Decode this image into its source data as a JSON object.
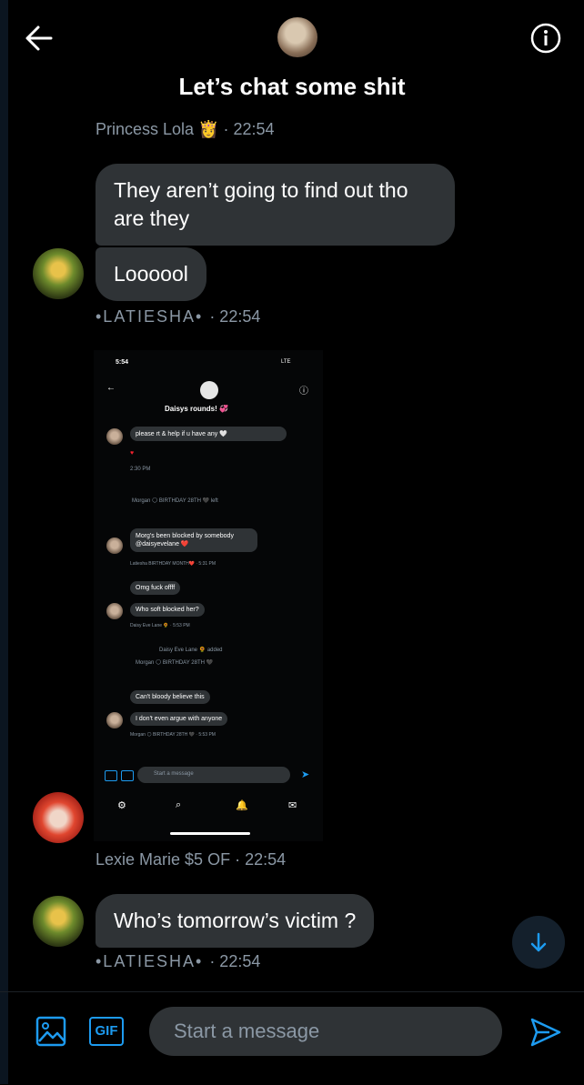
{
  "header": {
    "title": "Let’s chat some shit"
  },
  "messages": [
    {
      "sender": "Princess Lola 👸",
      "time": "· 22:54"
    },
    {
      "text": "They aren’t going to find out tho are they"
    },
    {
      "text": "Loooool"
    },
    {
      "sender": "•LATIESHA•",
      "time": "· 22:54"
    },
    {
      "sender": "Lexie Marie $5 OF",
      "time": "· 22:54"
    },
    {
      "text": "Who’s tomorrow’s victim ?"
    },
    {
      "sender": "•LATIESHA•",
      "time": "· 22:54"
    }
  ],
  "screenshot": {
    "status_time": "5:54",
    "status_net": "LTE",
    "title": "Daisys rounds! 💞",
    "m1": "please rt & help if u have any 🤍",
    "m1_time": "2:30 PM",
    "sys1": "Morgan 🌕 BIRTHDAY 28TH 🖤 left",
    "m2": "Morg's been blocked by somebody @daisyevelane ❤️",
    "m2_meta": "Latiesha BIRTHDAY MONTH❤️ · 5:31 PM",
    "m3": "Omg fuck offff",
    "m4": "Who soft blocked her?",
    "m4_meta": "Daisy Eve Lane 🌻 · 5:53 PM",
    "sys2": "Daisy Eve Lane 🌻 added",
    "sys3": "Morgan 🌕 BIRTHDAY 28TH 🖤",
    "m5": "Can't bloody believe this",
    "m6": "I don't even argue with anyone",
    "m6_meta": "Morgan 🌕 BIRTHDAY 28TH 🖤 · 5:53 PM",
    "input_placeholder": "Start a message"
  },
  "composer": {
    "gif_label": "GIF",
    "placeholder": "Start a message"
  },
  "colors": {
    "accent": "#1d9bf0",
    "bubble": "#2f3336",
    "meta": "#8b98a5"
  }
}
